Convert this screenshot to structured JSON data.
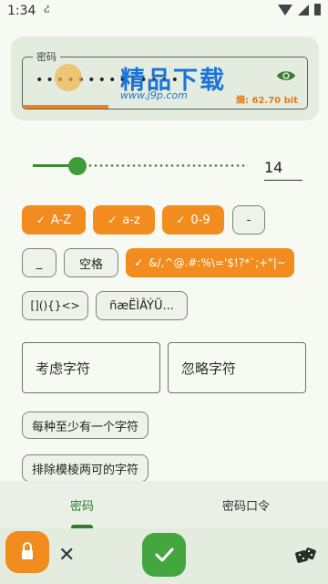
{
  "status": {
    "time": "1:34"
  },
  "password": {
    "label": "密码",
    "masked": "••••••••••••••",
    "strength_fraction": 0.3,
    "entropy": "熵: 62.70 bit"
  },
  "watermark": {
    "brand": "精品下载",
    "url": "www.j9p.com"
  },
  "length": {
    "value": "14",
    "min": 1,
    "max": 64
  },
  "charset_chips": [
    {
      "label": "A-Z",
      "checked": true
    },
    {
      "label": "a-z",
      "checked": true
    },
    {
      "label": "0-9",
      "checked": true
    },
    {
      "label": "-",
      "checked": false
    },
    {
      "label": "_",
      "checked": false
    },
    {
      "label": "空格",
      "checked": false
    },
    {
      "label": "&/,^@.#:%\\='$!?*`;+\"|~",
      "checked": true
    },
    {
      "label": "[](){}<>",
      "checked": false
    },
    {
      "label": "ñæËÌÂÝÜ...",
      "checked": false
    }
  ],
  "fields": {
    "consider": "考虑字符",
    "ignore": "忽略字符"
  },
  "options": {
    "at_least_one": "每种至少有一个字符",
    "exclude_ambiguous": "排除模棱两可的字符"
  },
  "tabs": [
    {
      "label": "密码",
      "active": true
    },
    {
      "label": "密码口令",
      "active": false
    }
  ],
  "colors": {
    "accent": "#f28c1e",
    "primary": "#43a63f"
  }
}
